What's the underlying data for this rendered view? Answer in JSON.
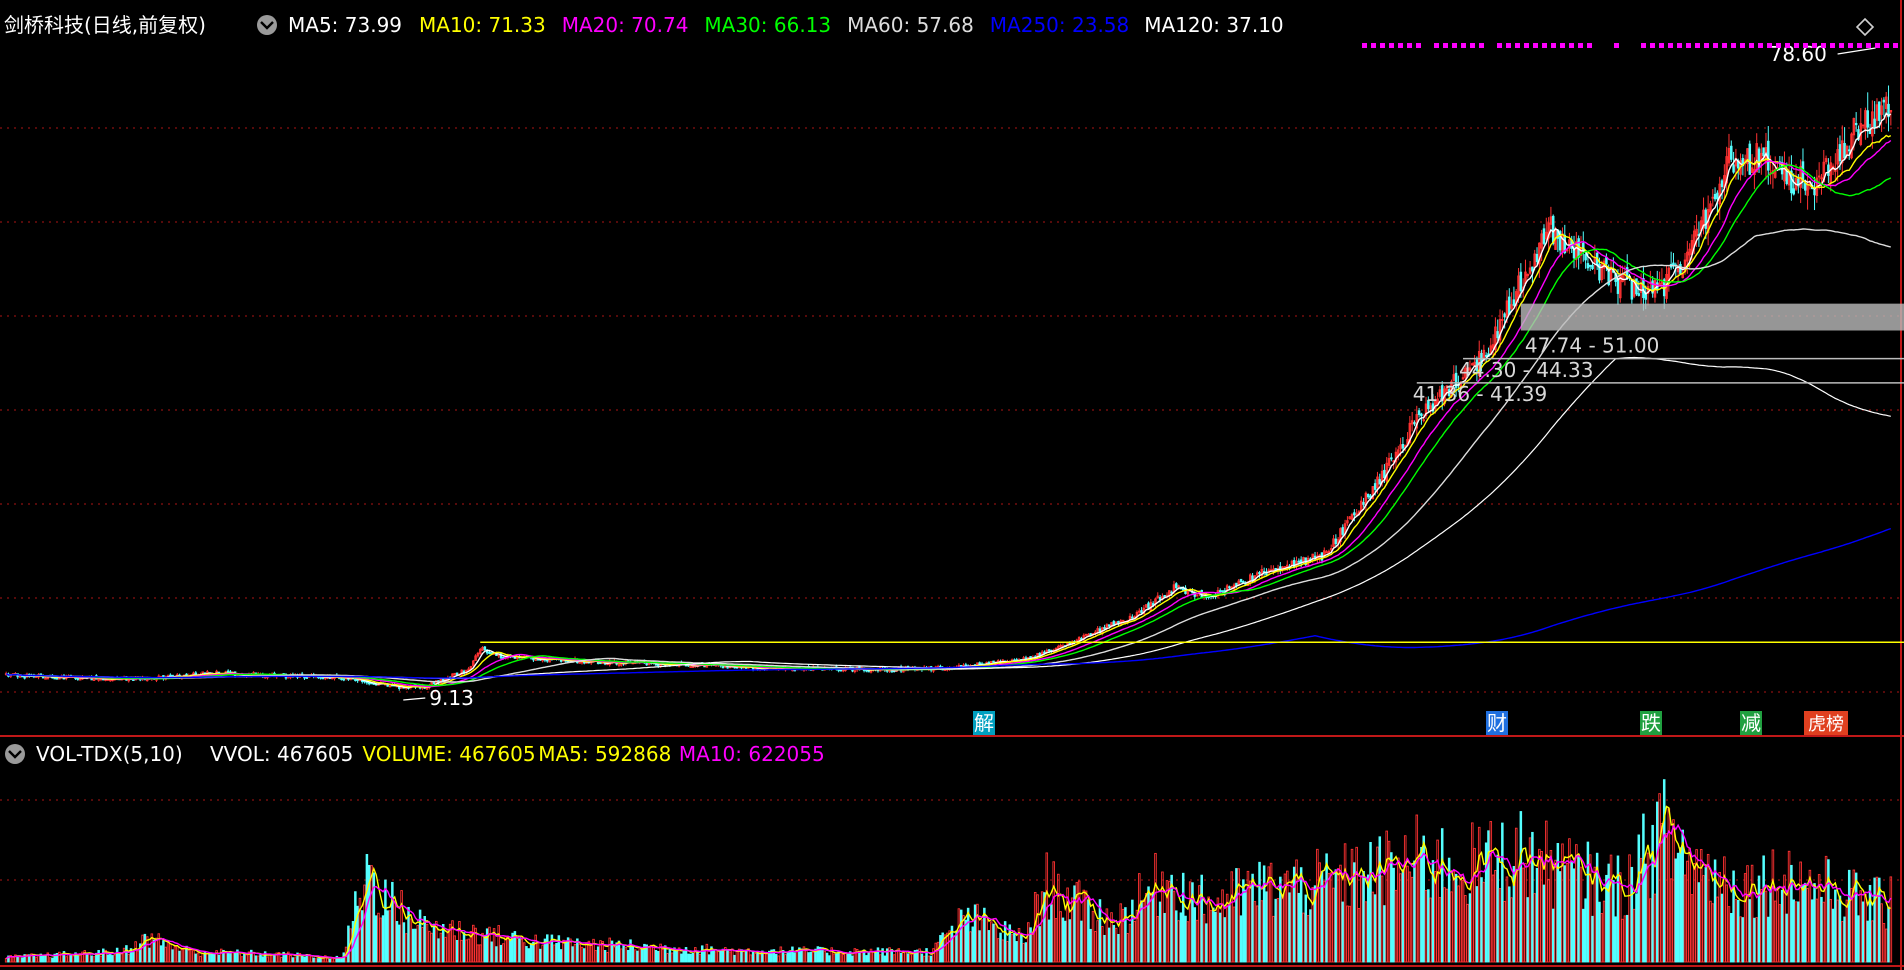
{
  "header": {
    "stock_name": "剑桥科技(日线,前复权)",
    "ma_readouts": [
      {
        "label": "MA5: 73.99",
        "color": "#ffffff"
      },
      {
        "label": "MA10: 71.33",
        "color": "#ffff00"
      },
      {
        "label": "MA20: 70.74",
        "color": "#ff00ff"
      },
      {
        "label": "MA30: 66.13",
        "color": "#00ff00"
      },
      {
        "label": "MA60: 57.68",
        "color": "#dddddd"
      },
      {
        "label": "MA250: 23.58",
        "color": "#0000ff"
      },
      {
        "label": "MA120: 37.10",
        "color": "#ffffff"
      }
    ]
  },
  "volume_header": {
    "indicator": "VOL-TDX(5,10)",
    "readouts": [
      {
        "label": "VVOL: 467605",
        "color": "#ffffff"
      },
      {
        "label": "VOLUME: 467605",
        "color": "#ffff00"
      },
      {
        "label": "MA5: 592868",
        "color": "#ffff00"
      },
      {
        "label": "MA10: 622055",
        "color": "#ff00ff"
      }
    ]
  },
  "chart_data": [
    {
      "type": "candlestick",
      "price_range": [
        3.5,
        83
      ],
      "grid": "dotted-red",
      "annotations": {
        "high_label": "78.60",
        "low_label": "9.13",
        "gap_zones": [
          {
            "label": "47.74 - 51.00",
            "low": 47.74,
            "high": 51.0
          },
          {
            "label": "44.30 - 44.33",
            "low": 44.3,
            "high": 44.33
          },
          {
            "label": "41.36 - 41.39",
            "low": 41.36,
            "high": 41.39
          }
        ],
        "reference_line": 9.9,
        "event_markers": [
          {
            "label": "解",
            "color": "#00a0c0"
          },
          {
            "label": "财",
            "color": "#2070e0"
          },
          {
            "label": "跌",
            "color": "#20a040"
          },
          {
            "label": "减",
            "color": "#20a040"
          },
          {
            "label": "龙虎榜",
            "color": "#e04020"
          }
        ]
      },
      "ma_series": [
        {
          "name": "MA5",
          "color": "#ffffff"
        },
        {
          "name": "MA10",
          "color": "#ffff00"
        },
        {
          "name": "MA20",
          "color": "#ff00ff"
        },
        {
          "name": "MA30",
          "color": "#00ff00"
        },
        {
          "name": "MA60",
          "color": "#dddddd"
        },
        {
          "name": "MA120",
          "color": "#ffffff"
        },
        {
          "name": "MA250",
          "color": "#0000ff"
        }
      ],
      "keypoints": [
        [
          0,
          6
        ],
        [
          30,
          5.6
        ],
        [
          60,
          5.4
        ],
        [
          90,
          6.2
        ],
        [
          120,
          5.8
        ],
        [
          150,
          5.6
        ],
        [
          165,
          4.6
        ],
        [
          180,
          4.4
        ],
        [
          200,
          6.6
        ],
        [
          205,
          9.2
        ],
        [
          212,
          8.3
        ],
        [
          225,
          7.9
        ],
        [
          260,
          7.5
        ],
        [
          300,
          7.1
        ],
        [
          340,
          6.7
        ],
        [
          380,
          6.6
        ],
        [
          410,
          6.8
        ],
        [
          432,
          7.6
        ],
        [
          445,
          8.2
        ],
        [
          470,
          11
        ],
        [
          490,
          13.5
        ],
        [
          505,
          16.5
        ],
        [
          520,
          15.5
        ],
        [
          545,
          18.5
        ],
        [
          570,
          20.5
        ],
        [
          590,
          28
        ],
        [
          602,
          33
        ],
        [
          610,
          37
        ],
        [
          625,
          41
        ],
        [
          640,
          45
        ],
        [
          655,
          54
        ],
        [
          668,
          60
        ],
        [
          680,
          57
        ],
        [
          695,
          54
        ],
        [
          710,
          52
        ],
        [
          725,
          55
        ],
        [
          745,
          68
        ],
        [
          760,
          69
        ],
        [
          772,
          66
        ],
        [
          785,
          66
        ],
        [
          800,
          72
        ],
        [
          815,
          76
        ]
      ]
    },
    {
      "type": "bar",
      "title": "VOL-TDX(5,10)",
      "volume_range": [
        0,
        1000000
      ],
      "latest_volume": 467605,
      "ma5": 592868,
      "ma10": 622055,
      "keypoints": [
        [
          0,
          25000
        ],
        [
          50,
          55000
        ],
        [
          62,
          130000
        ],
        [
          80,
          55000
        ],
        [
          120,
          40000
        ],
        [
          145,
          20000
        ],
        [
          156,
          500000
        ],
        [
          165,
          330000
        ],
        [
          180,
          200000
        ],
        [
          230,
          110000
        ],
        [
          280,
          80000
        ],
        [
          320,
          60000
        ],
        [
          400,
          55000
        ],
        [
          415,
          250000
        ],
        [
          440,
          120000
        ],
        [
          450,
          420000
        ],
        [
          465,
          300000
        ],
        [
          480,
          220000
        ],
        [
          500,
          450000
        ],
        [
          520,
          310000
        ],
        [
          540,
          400000
        ],
        [
          570,
          430000
        ],
        [
          595,
          500000
        ],
        [
          610,
          560000
        ],
        [
          630,
          520000
        ],
        [
          655,
          590000
        ],
        [
          680,
          470000
        ],
        [
          700,
          410000
        ],
        [
          716,
          720000
        ],
        [
          730,
          530000
        ],
        [
          750,
          410000
        ],
        [
          770,
          470000
        ],
        [
          815,
          300000
        ]
      ]
    }
  ]
}
